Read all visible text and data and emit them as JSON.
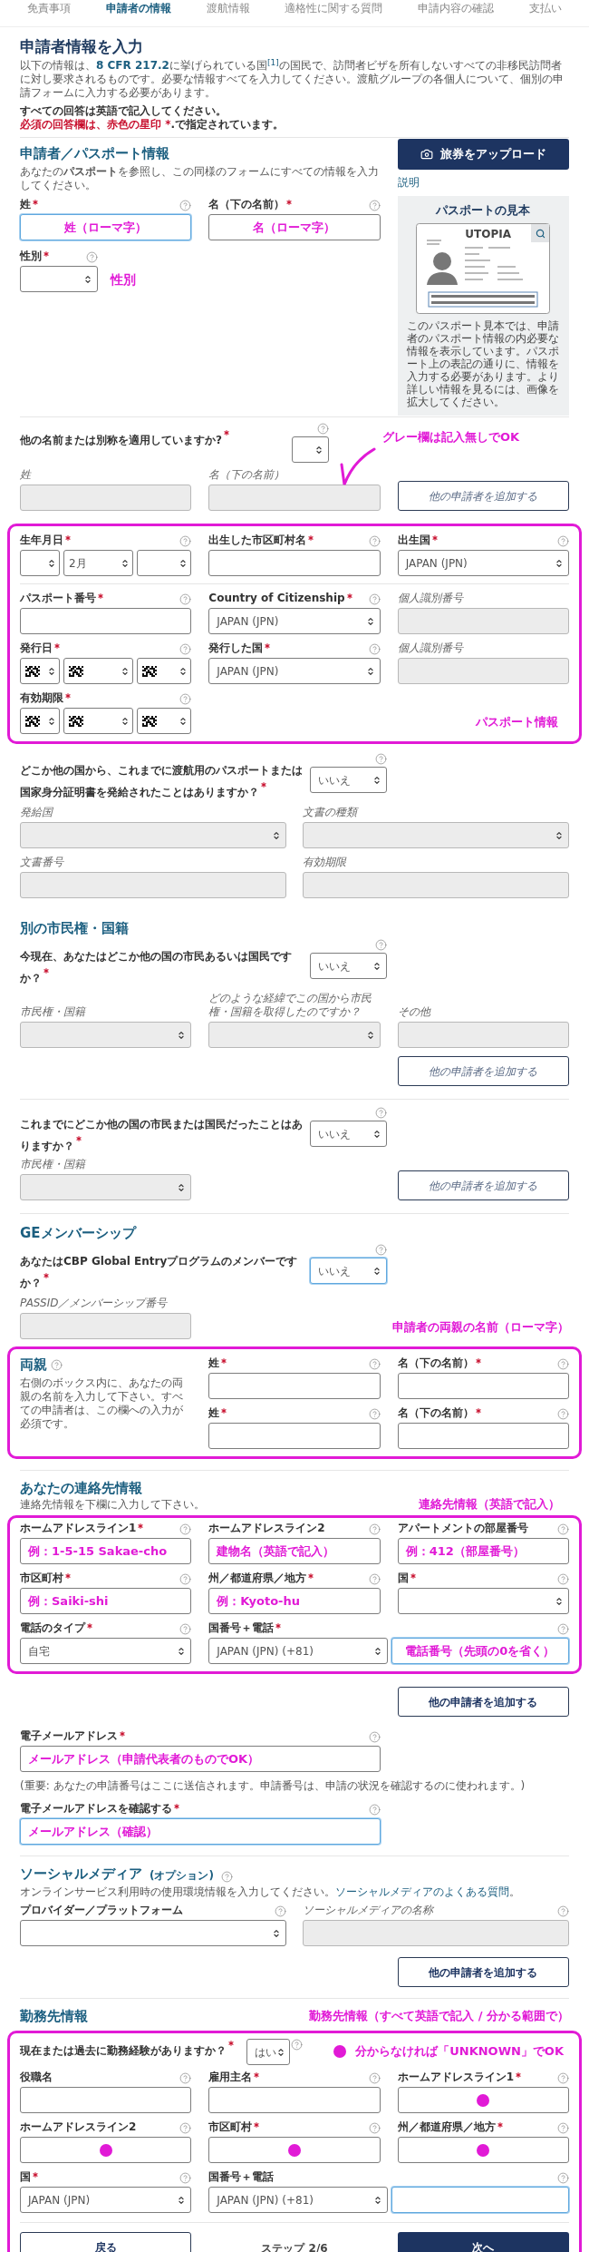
{
  "steps": [
    {
      "label": "免責事項",
      "selected": false
    },
    {
      "label": "申請者の情報",
      "selected": true
    },
    {
      "label": "渡航情報",
      "selected": false
    },
    {
      "label": "適格性に関する質問",
      "selected": false
    },
    {
      "label": "申請内容の確認",
      "selected": false
    },
    {
      "label": "支払い",
      "selected": false
    }
  ],
  "header": {
    "title": "申請者情報を入力",
    "intro": {
      "before": "以下の情報は、",
      "link": "8 CFR 217.2",
      "middle": "に挙げられている国",
      "footnote": "[1]",
      "after": "の国民で、訪問者ビザを所有しないすべての非移民訪問者に対し要求されるものです。必要な情報すべてを入力してください。渡航グループの各個人について、個別の申請フォームに入力する必要があります。"
    },
    "english_note": "すべての回答は英語で記入してください。",
    "required_note": {
      "red": "必須の回答欄は、赤色の星印 *",
      "rest": ".で指定されています。"
    }
  },
  "applicant": {
    "heading": "申請者／パスポート情報",
    "description": "あなたの**パスポート**を参照し、この同様のフォームにすべての情報を入力してください。",
    "upload_button": "旅券をアップロード",
    "help_link": "説明",
    "sample": {
      "title": "パスポートの見本",
      "card_label": "UTOPIA",
      "caption": "このパスポート見本では、申請者のパスポート情報の内必要な情報を表示しています。パスポート上の表記の通りに、情報を入力する必要があります。より詳しい情報を見るには、画像を拡大してください。"
    },
    "surname": {
      "label": "姓",
      "required": true,
      "help": true,
      "disabled": false,
      "focused": true,
      "kind": "text",
      "annotation": "姓（ローマ字）"
    },
    "given_name": {
      "label": "名（下の名前）",
      "required": true,
      "help": true,
      "disabled": false,
      "focused": false,
      "kind": "text",
      "annotation": "名（ローマ字）"
    },
    "gender": {
      "label": "性別",
      "required": true,
      "help": true,
      "disabled": false,
      "focused": false,
      "kind": "select"
    },
    "gender_annotation": "性別"
  },
  "other_names": {
    "annotation": "グレー欄は記入無しでOK",
    "question": {
      "label": "他の名前または別称を適用していますか?",
      "required": true,
      "help": true,
      "disabled": false,
      "focused": false,
      "kind": "select"
    },
    "surname": {
      "label": "姓",
      "required": false,
      "help": false,
      "disabled": true,
      "focused": false,
      "kind": "text"
    },
    "given_name": {
      "label": "名（下の名前）",
      "required": false,
      "help": false,
      "disabled": true,
      "focused": false,
      "kind": "text"
    },
    "add_button": {
      "label": "他の申請者を追加する",
      "disabled": true
    }
  },
  "passport": {
    "annotation": "パスポート情報",
    "birth_date": {
      "label": "生年月日",
      "required": true,
      "help": true,
      "disabled": false,
      "focused": false,
      "kind": "date",
      "parts": [
        {
          "redacted": false
        },
        {
          "value": "2月",
          "redacted": false
        },
        {
          "redacted": false
        }
      ]
    },
    "birth_city": {
      "label": "出生した市区町村名",
      "required": true,
      "help": true,
      "disabled": false,
      "focused": false,
      "kind": "text"
    },
    "birth_country": {
      "label": "出生国",
      "required": true,
      "help": true,
      "disabled": false,
      "focused": false,
      "kind": "select",
      "value": "JAPAN (JPN)"
    },
    "passport_number": {
      "label": "パスポート番号",
      "required": true,
      "help": true,
      "disabled": false,
      "focused": false,
      "kind": "text"
    },
    "citizenship": {
      "label": "Country of Citizenship",
      "required": true,
      "help": true,
      "disabled": false,
      "focused": false,
      "kind": "select",
      "value": "JAPAN (JPN)"
    },
    "personal_id": {
      "label": "個人識別番号",
      "required": false,
      "help": false,
      "disabled": true,
      "focused": false,
      "kind": "text"
    },
    "issue_date": {
      "label": "発行日",
      "required": true,
      "help": true,
      "disabled": false,
      "focused": false,
      "kind": "date",
      "parts": [
        {
          "redacted": true
        },
        {
          "redacted": true
        },
        {
          "redacted": true
        }
      ]
    },
    "issuing_country": {
      "label": "発行した国",
      "required": true,
      "help": true,
      "disabled": false,
      "focused": false,
      "kind": "select",
      "value": "JAPAN (JPN)"
    },
    "personal_id_2": {
      "label": "個人識別番号",
      "required": false,
      "help": false,
      "disabled": true,
      "focused": false,
      "kind": "text"
    },
    "expiry_date": {
      "label": "有効期限",
      "required": true,
      "help": true,
      "disabled": false,
      "focused": false,
      "kind": "date",
      "parts": [
        {
          "redacted": true
        },
        {
          "redacted": true
        },
        {
          "redacted": true
        }
      ]
    }
  },
  "other_documents": {
    "question": {
      "label": "どこか他の国から、これまでに渡航用のパスポートまたは国家身分証明書を発給されたことはありますか？",
      "required": true,
      "help": true,
      "disabled": false,
      "focused": false,
      "kind": "select",
      "value": "いいえ"
    },
    "fields": [
      {
        "label": "発給国",
        "required": false,
        "help": false,
        "disabled": true,
        "focused": false,
        "kind": "select"
      },
      {
        "label": "文書の種類",
        "required": false,
        "help": false,
        "disabled": true,
        "focused": false,
        "kind": "select"
      },
      {
        "label": "文書番号",
        "required": false,
        "help": false,
        "disabled": true,
        "focused": false,
        "kind": "text"
      },
      {
        "label": "有効期限",
        "required": false,
        "help": false,
        "disabled": true,
        "focused": false,
        "kind": "text"
      }
    ]
  },
  "citizenship": {
    "heading": "別の市民権・国籍",
    "question": {
      "label": "今現在、あなたはどこか他の国の市民あるいは国民ですか？",
      "required": true,
      "help": true,
      "disabled": false,
      "focused": false,
      "kind": "select",
      "value": "いいえ"
    },
    "fields": [
      {
        "label": "市民権・国籍",
        "required": false,
        "help": false,
        "disabled": true,
        "focused": false,
        "kind": "select"
      },
      {
        "label": "どのような経緯でこの国から市民権・国籍を取得したのですか？",
        "required": false,
        "help": false,
        "disabled": true,
        "focused": false,
        "kind": "select"
      },
      {
        "label": "その他",
        "required": false,
        "help": false,
        "disabled": true,
        "focused": false,
        "kind": "text"
      }
    ],
    "add_button": {
      "label": "他の申請者を追加する",
      "disabled": true
    },
    "past_question": {
      "label": "これまでにどこか他の国の市民または国民だったことはありますか？",
      "required": true,
      "help": true,
      "disabled": false,
      "focused": false,
      "kind": "select",
      "value": "いいえ"
    },
    "past_country": {
      "label": "市民権・国籍",
      "required": false,
      "help": false,
      "disabled": true,
      "focused": false,
      "kind": "select"
    },
    "past_add_button": {
      "label": "他の申請者を追加する",
      "disabled": true
    }
  },
  "ge_membership": {
    "heading": "GEメンバーシップ",
    "question": {
      "label": "あなたはCBP Global Entryプログラムのメンバーですか？",
      "required": true,
      "help": true,
      "disabled": false,
      "focused": true,
      "kind": "select",
      "value": "いいえ"
    },
    "pass_id": {
      "label": "PASSID／メンバーシップ番号",
      "required": false,
      "help": false,
      "disabled": true,
      "focused": false,
      "kind": "text"
    }
  },
  "parents": {
    "annotation": "申請者の両親の名前（ローマ字）",
    "heading": "両親",
    "help": true,
    "description": "右側のボックス内に、あなたの両親の名前を入力して下さい。すべての申請者は、この欄への入力が必須です。",
    "rows": [
      [
        {
          "label": "姓",
          "required": true,
          "help": true,
          "disabled": false,
          "focused": false,
          "kind": "text"
        },
        {
          "label": "名（下の名前）",
          "required": true,
          "help": true,
          "disabled": false,
          "focused": false,
          "kind": "text"
        }
      ],
      [
        {
          "label": "姓",
          "required": true,
          "help": true,
          "disabled": false,
          "focused": false,
          "kind": "text"
        },
        {
          "label": "名（下の名前）",
          "required": true,
          "help": true,
          "disabled": false,
          "focused": false,
          "kind": "text"
        }
      ]
    ]
  },
  "contact": {
    "heading": "あなたの連絡先情報",
    "description": "連絡先情報を下欄に入力して下さい。",
    "annotation": "連絡先情報（英語で記入）",
    "fields": [
      {
        "label": "ホームアドレスライン1",
        "required": true,
        "help": true,
        "disabled": false,
        "focused": false,
        "kind": "text",
        "annotation": "例：1-5-15 Sakae-cho"
      },
      {
        "label": "ホームアドレスライン2",
        "required": false,
        "help": true,
        "disabled": false,
        "focused": false,
        "kind": "text",
        "annotation": "建物名（英語で記入）"
      },
      {
        "label": "アパートメントの部屋番号",
        "required": false,
        "help": true,
        "disabled": false,
        "focused": false,
        "kind": "text",
        "annotation": "例：412（部屋番号）"
      },
      {
        "label": "市区町村",
        "required": true,
        "help": true,
        "disabled": false,
        "focused": false,
        "kind": "text",
        "annotation": "例：Saiki-shi"
      },
      {
        "label": "州／都道府県／地方",
        "required": true,
        "help": true,
        "disabled": false,
        "focused": false,
        "kind": "text",
        "annotation": "例：Kyoto-hu"
      },
      {
        "label": "国",
        "required": true,
        "help": true,
        "disabled": false,
        "focused": false,
        "kind": "select"
      },
      {
        "label": "電話のタイプ",
        "required": true,
        "help": true,
        "disabled": false,
        "focused": false,
        "kind": "select",
        "value": "自宅"
      },
      {
        "label": "国番号＋電話",
        "required": true,
        "help": true,
        "disabled": false,
        "focused": true,
        "kind": "phone",
        "value": "JAPAN (JPN) (+81)",
        "annotation": "電話番号（先頭の0を省く）"
      }
    ],
    "add_button": {
      "label": "他の申請者を追加する",
      "disabled": false
    }
  },
  "email": {
    "address": {
      "label": "電子メールアドレス",
      "required": true,
      "help": true,
      "disabled": false,
      "focused": false,
      "kind": "text",
      "annotation": "メールアドレス（申請代表者のものでOK）"
    },
    "note": "(重要: あなたの申請番号はここに送信されます。申請番号は、申請の状況を確認するのに使われます。)",
    "confirm": {
      "label": "電子メールアドレスを確認する",
      "required": true,
      "help": true,
      "disabled": false,
      "focused": true,
      "kind": "text",
      "annotation": "メールアドレス（確認）"
    }
  },
  "social_media": {
    "heading": "ソーシャルメディア",
    "optional": "(オプション)",
    "help": true,
    "description": "オンラインサービス利用時の使用環境情報を入力してください。",
    "link": "ソーシャルメディアのよくある質問",
    "after": "。",
    "fields": [
      {
        "label": "プロバイダー／プラットフォーム",
        "required": false,
        "help": true,
        "disabled": false,
        "focused": false,
        "kind": "select"
      },
      {
        "label": "ソーシャルメディアの名称",
        "required": false,
        "help": true,
        "disabled": true,
        "focused": false,
        "kind": "text"
      }
    ],
    "add_button": {
      "label": "他の申請者を追加する",
      "disabled": false
    }
  },
  "employment": {
    "heading": "勤務先情報",
    "annotation": "勤務先情報（すべて英語で記入 / 分かる範囲で）",
    "note": "分からなければ「UNKNOWN」でOK",
    "question": {
      "label": "現在または過去に勤務経験がありますか？",
      "required": true,
      "help": true,
      "disabled": false,
      "focused": false,
      "kind": "select",
      "value": "はい"
    },
    "fields": [
      {
        "label": "役職名",
        "required": false,
        "help": true,
        "disabled": false,
        "focused": false,
        "kind": "text",
        "dot": false
      },
      {
        "label": "雇用主名",
        "required": true,
        "help": true,
        "disabled": false,
        "focused": false,
        "kind": "text",
        "dot": false
      },
      {
        "label": "ホームアドレスライン1",
        "required": true,
        "help": true,
        "disabled": false,
        "focused": false,
        "kind": "text",
        "dot": true
      },
      {
        "label": "ホームアドレスライン2",
        "required": false,
        "help": true,
        "disabled": false,
        "focused": false,
        "kind": "text",
        "dot": true
      },
      {
        "label": "市区町村",
        "required": true,
        "help": true,
        "disabled": false,
        "focused": false,
        "kind": "text",
        "dot": true
      },
      {
        "label": "州／都道府県／地方",
        "required": true,
        "help": true,
        "disabled": false,
        "focused": false,
        "kind": "text",
        "dot": true
      },
      {
        "label": "国",
        "required": true,
        "help": true,
        "disabled": false,
        "focused": false,
        "kind": "select",
        "value": "JAPAN (JPN)"
      },
      {
        "label": "国番号＋電話",
        "required": false,
        "help": true,
        "disabled": false,
        "focused": true,
        "kind": "phone",
        "value": "JAPAN (JPN) (+81)"
      }
    ]
  },
  "footer": {
    "back": "戻る",
    "step": "ステップ 2/6",
    "next": "次へ"
  }
}
